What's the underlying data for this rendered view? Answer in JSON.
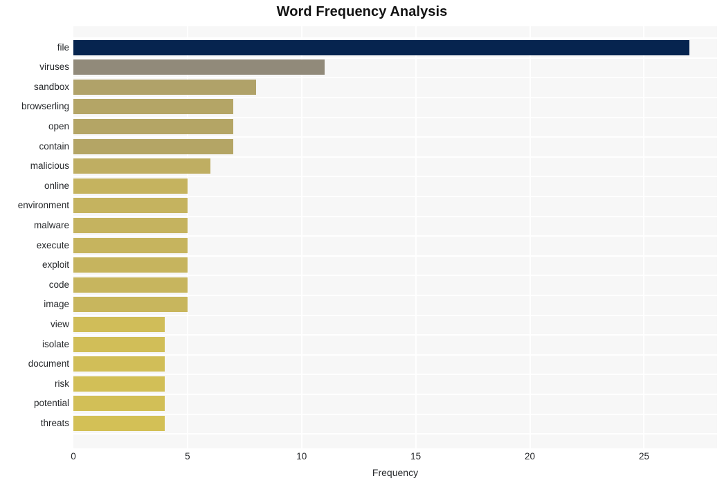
{
  "chart_data": {
    "type": "bar",
    "orientation": "horizontal",
    "title": "Word Frequency Analysis",
    "xlabel": "Frequency",
    "ylabel": "",
    "xlim": [
      0,
      28.2
    ],
    "xticks": [
      0,
      5,
      10,
      15,
      20,
      25
    ],
    "xtick_labels": [
      "0",
      "5",
      "10",
      "15",
      "20",
      "25"
    ],
    "grid": true,
    "grid_color": "#ffffff",
    "plot_background": "#f7f7f7",
    "figure_background": "#ffffff",
    "categories": [
      "file",
      "viruses",
      "sandbox",
      "browserling",
      "open",
      "contain",
      "malicious",
      "online",
      "environment",
      "malware",
      "execute",
      "exploit",
      "code",
      "image",
      "view",
      "isolate",
      "document",
      "risk",
      "potential",
      "threats"
    ],
    "values": [
      27,
      11,
      8,
      7,
      7,
      7,
      6,
      5,
      5,
      5,
      5,
      5,
      5,
      5,
      4,
      4,
      4,
      4,
      4,
      4
    ],
    "bar_colors": [
      "#06244f",
      "#918a7a",
      "#b0a269",
      "#b4a566",
      "#b4a565",
      "#b4a565",
      "#bfae62",
      "#c5b35f",
      "#c5b35f",
      "#c5b35f",
      "#c6b45e",
      "#c6b45e",
      "#c7b55e",
      "#c8b65d",
      "#d0bd59",
      "#d1be58",
      "#d1be58",
      "#d2bf57",
      "#d2bf57",
      "#d3c056"
    ]
  }
}
